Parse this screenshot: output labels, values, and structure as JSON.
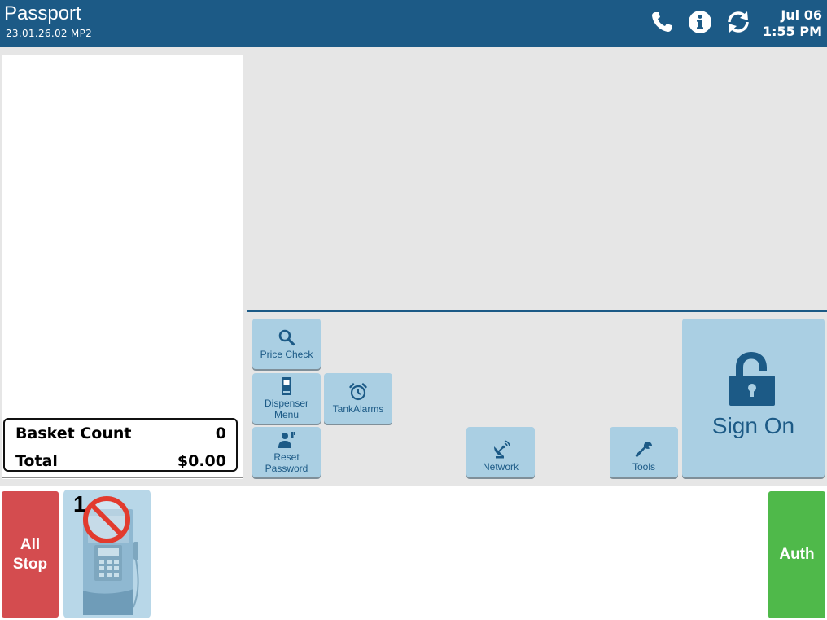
{
  "header": {
    "title": "Passport",
    "version": "23.01.26.02 MP2",
    "date": "Jul 06",
    "time": "1:55 PM",
    "icons": [
      "phone-icon",
      "info-icon",
      "refresh-icon"
    ]
  },
  "receipt": {
    "basket_count_label": "Basket Count",
    "basket_count_value": "0",
    "total_label": "Total",
    "total_value": "$0.00"
  },
  "functions": {
    "price_check": "Price Check",
    "dispenser_menu": "Dispenser Menu",
    "tank_alarms": "TankAlarms",
    "reset_password": "Reset Password",
    "network": "Network",
    "tools": "Tools",
    "sign_on": "Sign On"
  },
  "bottom_bar": {
    "all_stop": "All Stop",
    "pump_number": "1",
    "pump_status_icon": "no-entry-icon",
    "auth": "Auth"
  },
  "colors": {
    "header_bg": "#1c5a86",
    "button_bg": "#aacfe3",
    "all_stop_bg": "#d44c4f",
    "auth_bg": "#4fb94a"
  }
}
